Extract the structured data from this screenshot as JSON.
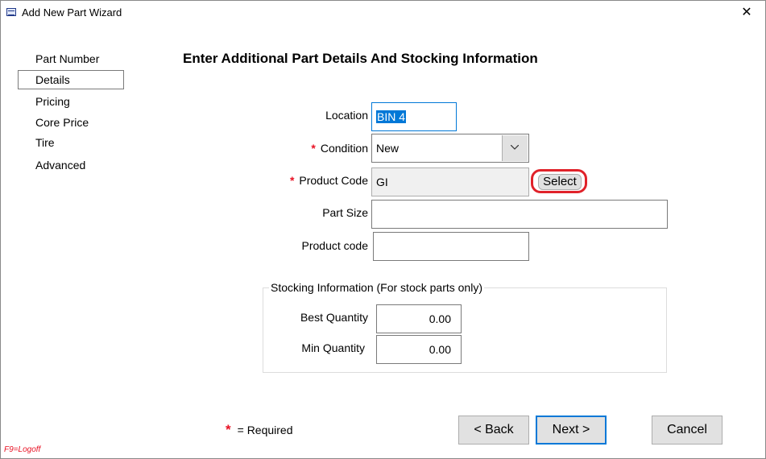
{
  "window": {
    "title": "Add New Part Wizard",
    "close_glyph": "✕"
  },
  "nav": {
    "items": [
      "Part Number",
      "Details",
      "Pricing",
      "Core Price",
      "Tire",
      "Advanced"
    ],
    "selected": "Details"
  },
  "heading": "Enter Additional Part Details And Stocking Information",
  "form": {
    "location_label": "Location",
    "location_value": "BIN 4",
    "condition_label": "Condition",
    "condition_value": "New",
    "product_code_label": "Product Code",
    "product_code_value": "GI",
    "select_label": "Select",
    "part_size_label": "Part Size",
    "part_size_value": "",
    "product_code2_label": "Product code",
    "product_code2_value": ""
  },
  "stocking": {
    "title": "Stocking Information  (For stock parts only)",
    "best_label": "Best Quantity",
    "best_value": "0.00",
    "min_label": "Min Quantity",
    "min_value": "0.00"
  },
  "required_star": "*",
  "required_note": "= Required",
  "buttons": {
    "back": "< Back",
    "next": "Next >",
    "cancel": "Cancel"
  },
  "footer_hint": "F9=Logoff",
  "colors": {
    "required": "#e81123",
    "focus_border": "#0078d7",
    "highlight_ring": "#e0222a"
  }
}
